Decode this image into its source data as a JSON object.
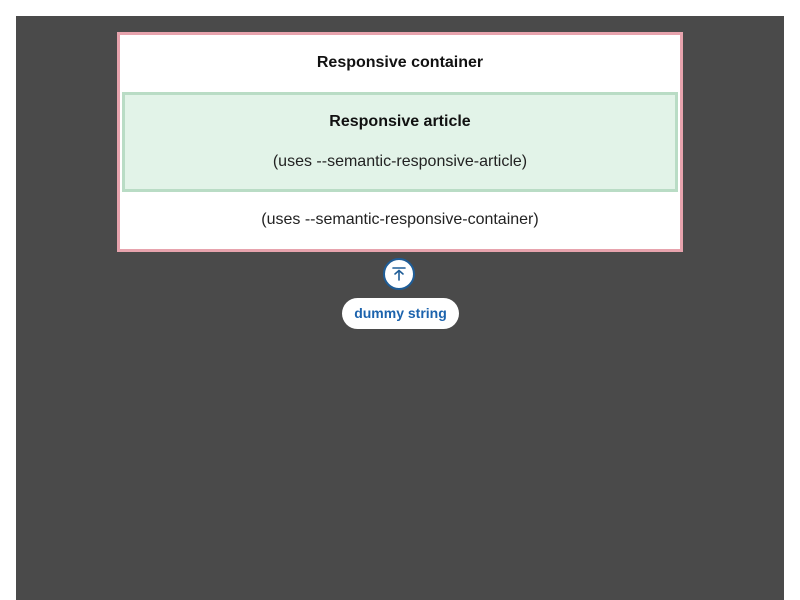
{
  "container": {
    "title": "Responsive container",
    "note": "(uses --semantic-responsive-container)"
  },
  "article": {
    "title": "Responsive article",
    "note": "(uses --semantic-responsive-article)"
  },
  "back_to_top": {
    "icon": "arrow-up-to-line-icon"
  },
  "tag": {
    "label": "dummy string"
  },
  "colors": {
    "background": "#4a4a4a",
    "container_border": "#e7a3ad",
    "article_background": "#e2f3e8",
    "article_border": "#b9dcc5",
    "accent": "#1c63ad"
  }
}
